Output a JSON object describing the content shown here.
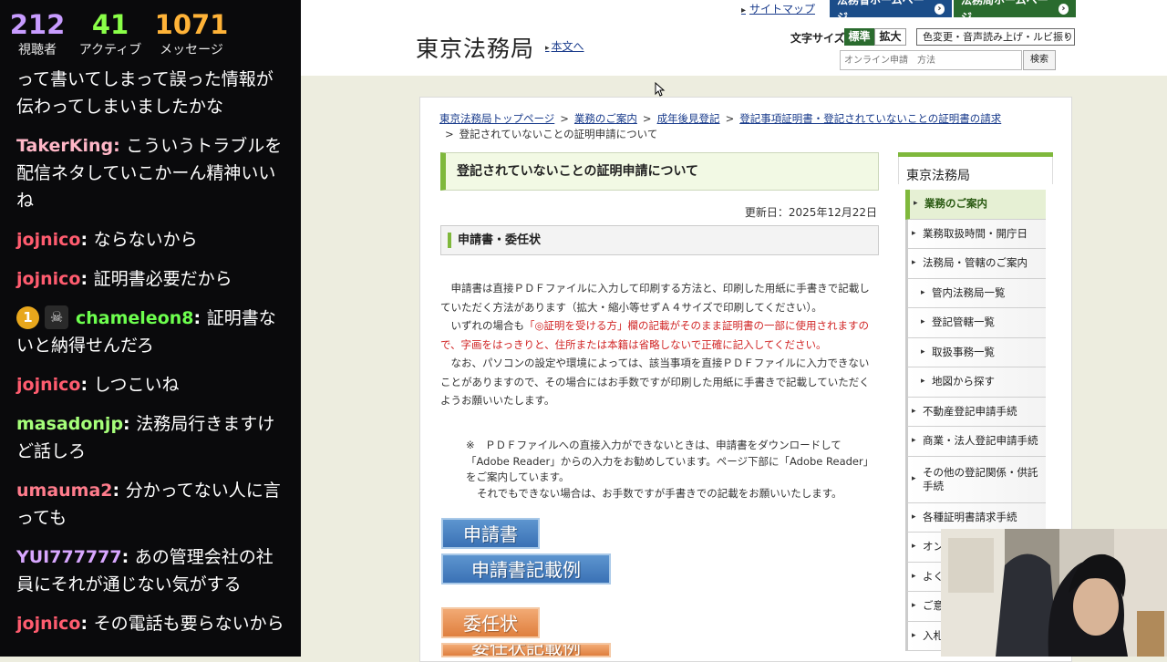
{
  "chat": {
    "stats": [
      {
        "value": "212",
        "label": "視聴者",
        "color": "#c89cff"
      },
      {
        "value": "41",
        "label": "アクティブ",
        "color": "#8aff48"
      },
      {
        "value": "1071",
        "label": "メッセージ",
        "color": "#ffb338"
      }
    ],
    "messages": [
      {
        "user": "",
        "text": "って書いてしまって誤った情報が伝わってしまいましたかな"
      },
      {
        "user": "TakerKing",
        "user_color": "#ffb7c7",
        "text": "こういうトラブルを配信ネタしていこかーん精神いいね"
      },
      {
        "user": "jojnico",
        "user_color": "#ff5c6f",
        "text": "ならないから"
      },
      {
        "user": "jojnico",
        "user_color": "#ff5c6f",
        "text": "証明書必要だから"
      },
      {
        "badge": "1",
        "user": "chameleon8",
        "user_color": "#6dff4e",
        "text": "証明書ないと納得せんだろ"
      },
      {
        "user": "jojnico",
        "user_color": "#ff5c6f",
        "text": "しつこいね"
      },
      {
        "user": "masadonjp",
        "user_color": "#a6ff7a",
        "text": "法務局行きますけど話しろ"
      },
      {
        "user": "umauma2",
        "user_color": "#ff7c8c",
        "text": "分かってない人に言っても"
      },
      {
        "user": "YUI777777",
        "user_color": "#d8a7ff",
        "text": "あの管理会社の社員にそれが通じない気がする"
      },
      {
        "user": "jojnico",
        "user_color": "#ff5c6f",
        "text": "その電話も要らないから"
      }
    ]
  },
  "header": {
    "sitemap": "サイトマップ",
    "moj_home": "法務省ホームページ",
    "legal_home": "法務局ホームページ",
    "site_title": "東京法務局",
    "skip_link": "本文へ",
    "fontsize_label": "文字サイズ",
    "fontsize_standard": "標準",
    "fontsize_large": "拡大",
    "color_button": "色変更・音声読み上げ・ルビ振り",
    "search_placeholder": "オンライン申請　方法",
    "search_button": "検索"
  },
  "breadcrumb": [
    "東京法務局トップページ",
    "業務のご案内",
    "成年後見登記",
    "登記事項証明書・登記されていないことの証明書の請求",
    "登記されていないことの証明申請について"
  ],
  "page": {
    "title": "登記されていないことの証明申請について",
    "update_date": "更新日：2025年12月22日",
    "section_heading": "申請書・委任状",
    "para1": "申請書は直接ＰＤＦファイルに入力して印刷する方法と、印刷した用紙に手書きで記載していただく方法があります（拡大・縮小等せずＡ４サイズで印刷してください）。",
    "para2_pre": "いずれの場合も",
    "para2_red": "「◎証明を受ける方」欄の記載がそのまま証明書の一部に使用されますので、字画をはっきりと、住所または本籍は省略しないで正確に記入してください。",
    "para3": "なお、パソコンの設定や環境によっては、該当事項を直接ＰＤＦファイルに入力できないことがありますので、その場合にはお手数ですが印刷した用紙に手書きで記載していただくようお願いいたします。",
    "note1": "※　ＰＤＦファイルへの直接入力ができないときは、申請書をダウンロードして「Adobe Reader」からの入力をお勧めしています。ページ下部に「Adobe Reader」をご案内しています。",
    "note2": "それでもできない場合は、お手数ですが手書きでの記載をお願いいたします。",
    "btn_apply": "申請書",
    "btn_apply_example": "申請書記載例",
    "btn_proxy": "委任状",
    "btn_proxy_example": "委任状記載例"
  },
  "sidenav": {
    "title": "東京法務局",
    "items": [
      {
        "label": "業務のご案内"
      },
      {
        "label": "業務取扱時間・開庁日"
      },
      {
        "label": "法務局・管轄のご案内"
      },
      {
        "label": "管内法務局一覧"
      },
      {
        "label": "登記管轄一覧"
      },
      {
        "label": "取扱事務一覧"
      },
      {
        "label": "地図から探す"
      },
      {
        "label": "不動産登記申請手続"
      },
      {
        "label": "商業・法人登記申請手続"
      },
      {
        "label": "その他の登記関係・供託手続"
      },
      {
        "label": "各種証明書請求手続"
      },
      {
        "label": "オン"
      },
      {
        "label": "よく"
      },
      {
        "label": "ご意"
      },
      {
        "label": "入札"
      }
    ]
  }
}
